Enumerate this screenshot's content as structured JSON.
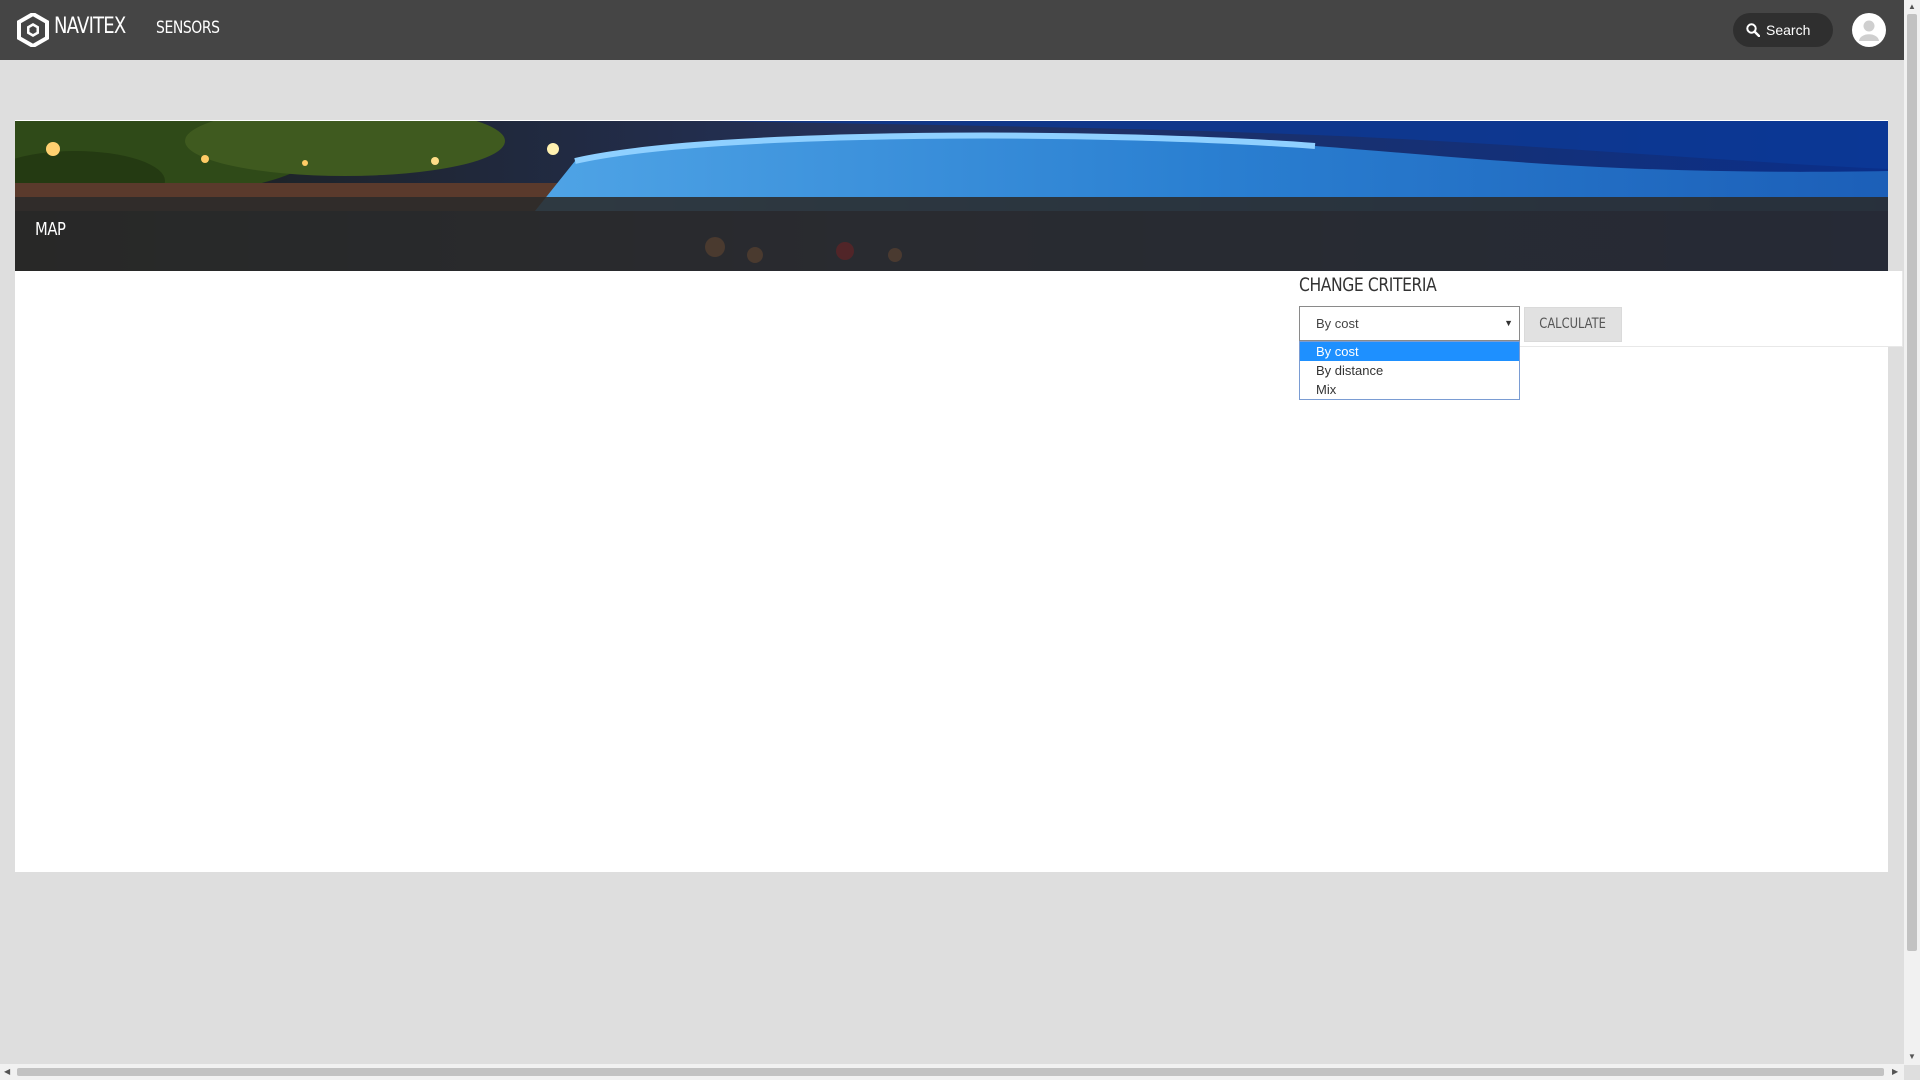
{
  "header": {
    "brand": "NAVITEX",
    "nav_sensors": "SENSORS",
    "search_label": "Search"
  },
  "banner": {
    "title": "MAP"
  },
  "criteria": {
    "heading": "CHANGE CRITERIA",
    "selected_value": "By cost",
    "options": [
      "By cost",
      "By distance",
      "Mix"
    ],
    "calculate_label": "CALCULATE"
  },
  "colors": {
    "topbar": "#454545",
    "page_background": "#dedede",
    "option_highlight": "#1e90ff"
  },
  "icons": {
    "logo": "navitex-hexagon-logo",
    "search": "search-icon",
    "avatar": "user-avatar-icon"
  }
}
